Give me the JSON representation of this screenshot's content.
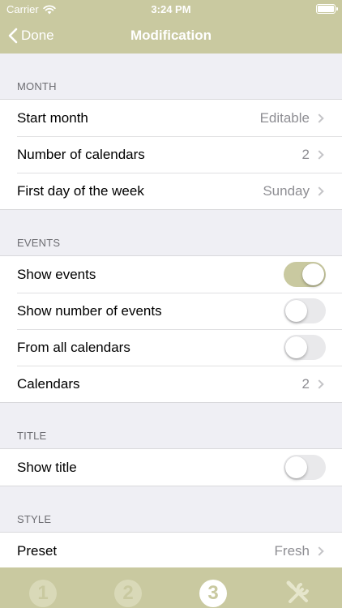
{
  "status": {
    "carrier": "Carrier",
    "time": "3:24 PM"
  },
  "nav": {
    "back_label": "Done",
    "title": "Modification"
  },
  "sections": {
    "month": {
      "header": "MONTH",
      "start_month": {
        "label": "Start month",
        "value": "Editable"
      },
      "number_of_calendars": {
        "label": "Number of calendars",
        "value": "2"
      },
      "first_day": {
        "label": "First day of the week",
        "value": "Sunday"
      }
    },
    "events": {
      "header": "EVENTS",
      "show_events": {
        "label": "Show events",
        "on": true
      },
      "show_number": {
        "label": "Show number of events",
        "on": false
      },
      "from_all": {
        "label": "From all calendars",
        "on": false
      },
      "calendars": {
        "label": "Calendars",
        "value": "2"
      }
    },
    "title": {
      "header": "TITLE",
      "show_title": {
        "label": "Show title",
        "on": false
      }
    },
    "style": {
      "header": "STYLE",
      "preset": {
        "label": "Preset",
        "value": "Fresh"
      }
    }
  },
  "tabs": [
    {
      "label": "1",
      "active": false
    },
    {
      "label": "2",
      "active": false
    },
    {
      "label": "3",
      "active": true
    },
    {
      "icon": "tools-icon",
      "active": false
    }
  ],
  "colors": {
    "accent": "#c9c9a0",
    "background": "#efeff4"
  }
}
